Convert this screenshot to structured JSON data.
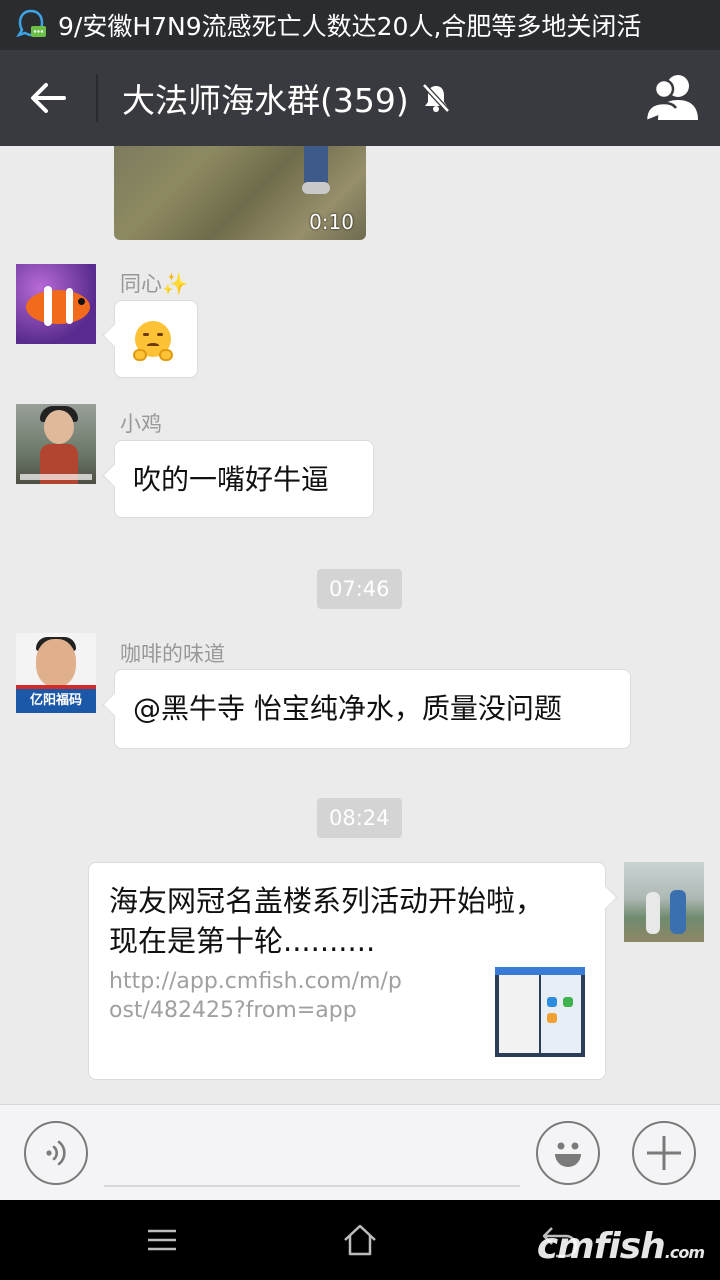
{
  "status_bar": {
    "notification_text": "9/安徽H7N9流感死亡人数达20人,合肥等多地关闭活"
  },
  "header": {
    "title": "大法师海水群(359)"
  },
  "messages": {
    "video": {
      "duration": "0:10"
    },
    "msg1": {
      "sender": "同心✨"
    },
    "msg2": {
      "sender": "小鸡",
      "text": "吹的一嘴好牛逼"
    },
    "time1": "07:46",
    "msg3": {
      "sender": "咖啡的味道",
      "text": "@黑牛寺 怡宝纯净水，质量没问题",
      "avatar_caption": "亿阳福码"
    },
    "time2": "08:24",
    "msg4": {
      "link_title": "海友网冠名盖楼系列活动开始啦，现在是第十轮..........",
      "link_url": "http://app.cmfish.com/m/post/482425?from=app"
    }
  },
  "input_bar": {
    "placeholder": ""
  },
  "watermark": {
    "text": "cmfish",
    "suffix": ".com"
  }
}
